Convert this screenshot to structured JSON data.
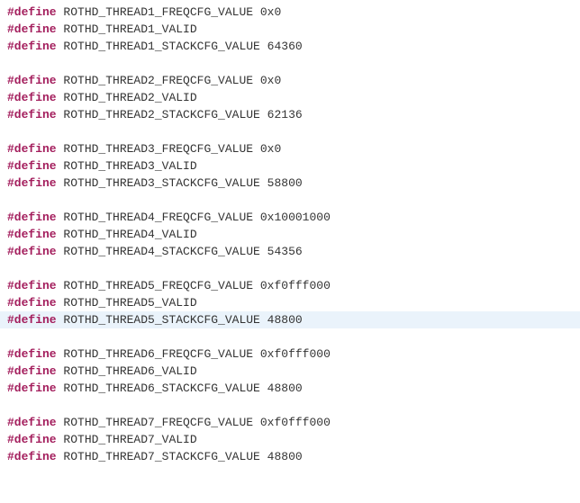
{
  "keyword": "#define",
  "threads": [
    {
      "freq_name": "ROTHD_THREAD1_FREQCFG_VALUE",
      "freq_val": "0x0",
      "valid_name": "ROTHD_THREAD1_VALID",
      "stack_name": "ROTHD_THREAD1_STACKCFG_VALUE",
      "stack_val": "64360"
    },
    {
      "freq_name": "ROTHD_THREAD2_FREQCFG_VALUE",
      "freq_val": "0x0",
      "valid_name": "ROTHD_THREAD2_VALID",
      "stack_name": "ROTHD_THREAD2_STACKCFG_VALUE",
      "stack_val": "62136"
    },
    {
      "freq_name": "ROTHD_THREAD3_FREQCFG_VALUE",
      "freq_val": "0x0",
      "valid_name": "ROTHD_THREAD3_VALID",
      "stack_name": "ROTHD_THREAD3_STACKCFG_VALUE",
      "stack_val": "58800"
    },
    {
      "freq_name": "ROTHD_THREAD4_FREQCFG_VALUE",
      "freq_val": "0x10001000",
      "valid_name": "ROTHD_THREAD4_VALID",
      "stack_name": "ROTHD_THREAD4_STACKCFG_VALUE",
      "stack_val": "54356"
    },
    {
      "freq_name": "ROTHD_THREAD5_FREQCFG_VALUE",
      "freq_val": "0xf0fff000",
      "valid_name": "ROTHD_THREAD5_VALID",
      "stack_name": "ROTHD_THREAD5_STACKCFG_VALUE",
      "stack_val": "48800",
      "highlight_stack": true
    },
    {
      "freq_name": "ROTHD_THREAD6_FREQCFG_VALUE",
      "freq_val": "0xf0fff000",
      "valid_name": "ROTHD_THREAD6_VALID",
      "stack_name": "ROTHD_THREAD6_STACKCFG_VALUE",
      "stack_val": "48800"
    },
    {
      "freq_name": "ROTHD_THREAD7_FREQCFG_VALUE",
      "freq_val": "0xf0fff000",
      "valid_name": "ROTHD_THREAD7_VALID",
      "stack_name": "ROTHD_THREAD7_STACKCFG_VALUE",
      "stack_val": "48800"
    }
  ]
}
